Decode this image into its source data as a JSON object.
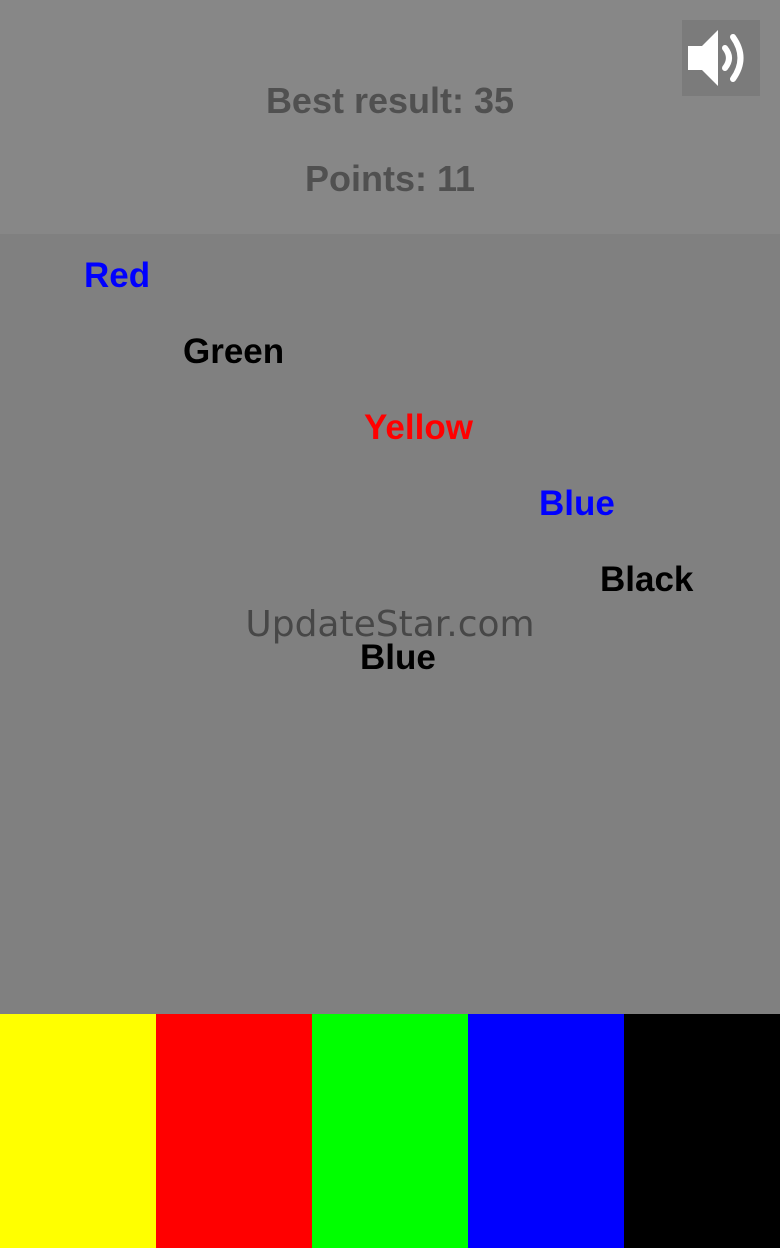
{
  "header": {
    "best_result": "Best result: 35",
    "points": "Points: 11",
    "sound_icon": "speaker-volume-icon"
  },
  "watermark": "UpdateStar.com",
  "falling_words": [
    {
      "text": "Red",
      "color": "#0000ff"
    },
    {
      "text": "Green",
      "color": "#000000"
    },
    {
      "text": "Yellow",
      "color": "#ff0000"
    },
    {
      "text": "Blue",
      "color": "#0000ff"
    },
    {
      "text": "Black",
      "color": "#000000"
    },
    {
      "text": "Blue",
      "color": "#000000"
    }
  ],
  "color_buttons": [
    {
      "name": "yellow",
      "color": "#ffff00"
    },
    {
      "name": "red",
      "color": "#ff0000"
    },
    {
      "name": "green",
      "color": "#00ff00"
    },
    {
      "name": "blue",
      "color": "#0000ff"
    },
    {
      "name": "black",
      "color": "#000000"
    }
  ]
}
